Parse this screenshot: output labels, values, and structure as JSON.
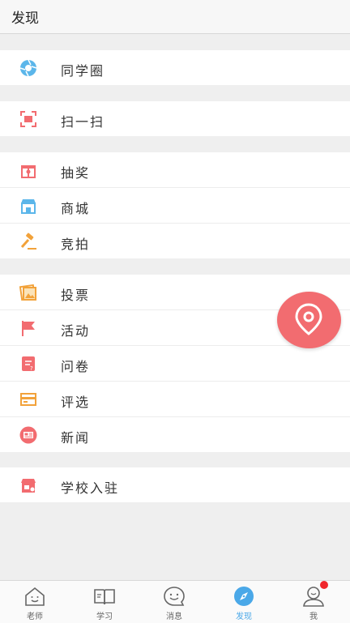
{
  "header": {
    "title": "发现"
  },
  "groups": [
    {
      "items": [
        {
          "label": "同学圈",
          "icon": "aperture-icon"
        }
      ]
    },
    {
      "items": [
        {
          "label": "扫一扫",
          "icon": "scan-icon"
        }
      ]
    },
    {
      "items": [
        {
          "label": "抽奖",
          "icon": "gift-icon"
        },
        {
          "label": "商城",
          "icon": "store-icon"
        },
        {
          "label": "竞拍",
          "icon": "gavel-icon"
        }
      ]
    },
    {
      "items": [
        {
          "label": "投票",
          "icon": "vote-picture-icon"
        },
        {
          "label": "活动",
          "icon": "flag-icon"
        },
        {
          "label": "问卷",
          "icon": "questionnaire-icon"
        },
        {
          "label": "评选",
          "icon": "selection-card-icon"
        },
        {
          "label": "新闻",
          "icon": "news-icon"
        }
      ]
    },
    {
      "items": [
        {
          "label": "学校入驻",
          "icon": "school-store-icon"
        }
      ]
    }
  ],
  "fab": {
    "icon": "location-pin-icon"
  },
  "tabbar": {
    "tabs": [
      {
        "label": "老师",
        "icon": "house-icon"
      },
      {
        "label": "学习",
        "icon": "book-icon"
      },
      {
        "label": "消息",
        "icon": "chat-face-icon"
      },
      {
        "label": "发现",
        "icon": "compass-icon",
        "active": true
      },
      {
        "label": "我",
        "icon": "user-icon"
      }
    ]
  },
  "colors": {
    "accent": "#4aa8e8",
    "fab": "#f26c70",
    "badge": "#f0262c"
  }
}
